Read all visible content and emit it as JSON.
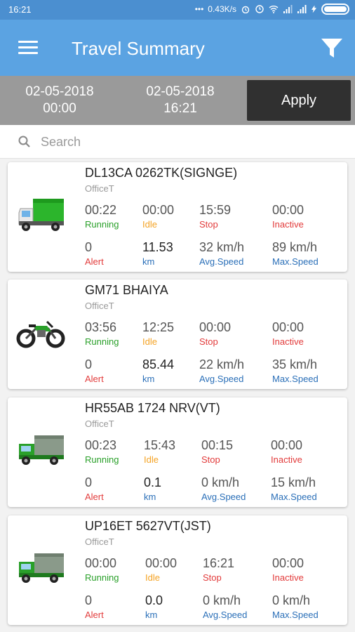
{
  "status_bar": {
    "time": "16:21",
    "network_speed": "0.43K/s",
    "icons": [
      "alarm-icon",
      "clock-icon",
      "wifi-icon",
      "signal-icon",
      "signal-icon",
      "charging-icon",
      "battery-icon"
    ]
  },
  "app_bar": {
    "title": "Travel Summary",
    "menu_icon": "hamburger-menu-icon",
    "filter_icon": "funnel-filter-icon"
  },
  "date_range": {
    "from_date": "02-05-2018",
    "from_time": "00:00",
    "to_date": "02-05-2018",
    "to_time": "16:21",
    "apply_label": "Apply"
  },
  "search": {
    "placeholder": "Search",
    "value": ""
  },
  "colors": {
    "app_bar": "#5ba3e2",
    "status_bar": "#4b8fd0",
    "date_bar": "#9a9a9a",
    "apply_button": "#303030",
    "running": "#2aa02a",
    "idle": "#f4a324",
    "stop": "#e23b3b",
    "inactive": "#e23b3b",
    "alert": "#e23b3b",
    "km": "#2a6fb8",
    "speed": "#2a6fb8"
  },
  "vehicles": [
    {
      "name": "DL13CA 0262TK(SIGNGE)",
      "org": "OfficeT",
      "icon": "green-truck-icon",
      "running": "00:22",
      "running_label": "Running",
      "idle": "00:00",
      "idle_label": "Idle",
      "stop": "15:59",
      "stop_label": "Stop",
      "inactive": "00:00",
      "inactive_label": "Inactive",
      "alert": "0",
      "alert_label": "Alert",
      "km": "11.53",
      "km_label": "km",
      "avg_speed": "32 km/h",
      "avg_label": "Avg.Speed",
      "max_speed": "89 km/h",
      "max_label": "Max.Speed"
    },
    {
      "name": "GM71 BHAIYA",
      "org": "OfficeT",
      "icon": "green-motorcycle-icon",
      "running": "03:56",
      "running_label": "Running",
      "idle": "12:25",
      "idle_label": "Idle",
      "stop": "00:00",
      "stop_label": "Stop",
      "inactive": "00:00",
      "inactive_label": "Inactive",
      "alert": "0",
      "alert_label": "Alert",
      "km": "85.44",
      "km_label": "km",
      "avg_speed": "22 km/h",
      "avg_label": "Avg.Speed",
      "max_speed": "35 km/h",
      "max_label": "Max.Speed"
    },
    {
      "name": "HR55AB 1724 NRV(VT)",
      "org": "OfficeT",
      "icon": "green-lorry-icon",
      "running": "00:23",
      "running_label": "Running",
      "idle": "15:43",
      "idle_label": "Idle",
      "stop": "00:15",
      "stop_label": "Stop",
      "inactive": "00:00",
      "inactive_label": "Inactive",
      "alert": "0",
      "alert_label": "Alert",
      "km": "0.1",
      "km_label": "km",
      "avg_speed": "0 km/h",
      "avg_label": "Avg.Speed",
      "max_speed": "15 km/h",
      "max_label": "Max.Speed"
    },
    {
      "name": "UP16ET 5627VT(JST)",
      "org": "OfficeT",
      "icon": "green-lorry-icon",
      "running": "00:00",
      "running_label": "Running",
      "idle": "00:00",
      "idle_label": "Idle",
      "stop": "16:21",
      "stop_label": "Stop",
      "inactive": "00:00",
      "inactive_label": "Inactive",
      "alert": "0",
      "alert_label": "Alert",
      "km": "0.0",
      "km_label": "km",
      "avg_speed": "0 km/h",
      "avg_label": "Avg.Speed",
      "max_speed": "0 km/h",
      "max_label": "Max.Speed"
    }
  ]
}
